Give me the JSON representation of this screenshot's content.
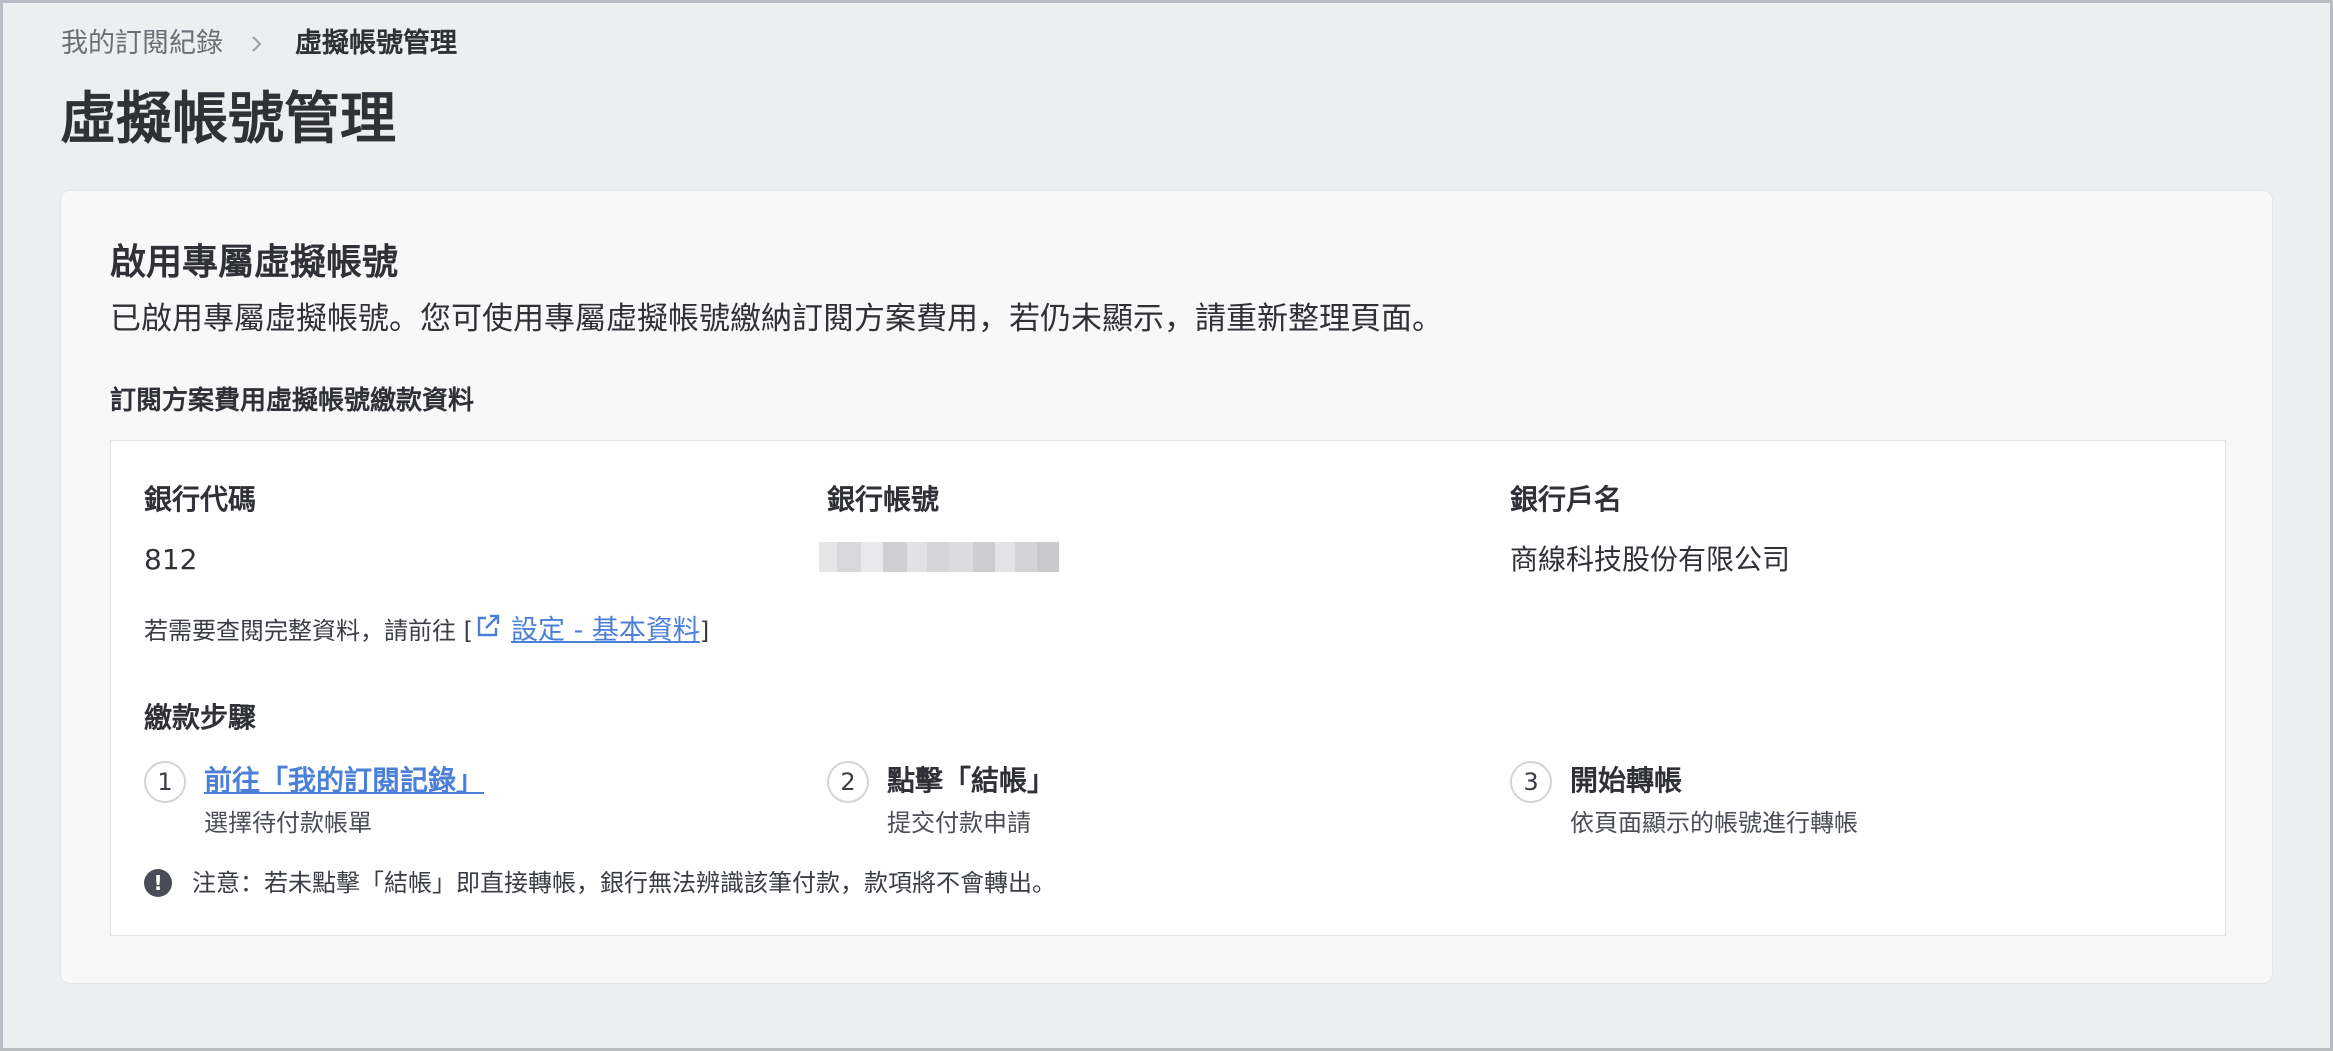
{
  "breadcrumb": {
    "parent": "我的訂閱紀錄",
    "current": "虛擬帳號管理"
  },
  "page_title": "虛擬帳號管理",
  "card": {
    "title": "啟用專屬虛擬帳號",
    "description": "已啟用專屬虛擬帳號。您可使用專屬虛擬帳號繳納訂閱方案費用，若仍未顯示，請重新整理頁面。",
    "section_label": "訂閱方案費用虛擬帳號繳款資料"
  },
  "bank": {
    "code_label": "銀行代碼",
    "code_value": "812",
    "account_label": "銀行帳號",
    "name_label": "銀行戶名",
    "name_value": "商線科技股份有限公司"
  },
  "settings_note": {
    "prefix": "若需要查閱完整資料，請前往 [",
    "link_label": "設定 - 基本資料",
    "suffix": "]"
  },
  "steps": {
    "label": "繳款步驟",
    "items": [
      {
        "num": "1",
        "title": "前往「我的訂閱記錄」",
        "sub": "選擇待付款帳單"
      },
      {
        "num": "2",
        "title": "點擊「結帳」",
        "sub": "提交付款申請"
      },
      {
        "num": "3",
        "title": "開始轉帳",
        "sub": "依頁面顯示的帳號進行轉帳"
      }
    ]
  },
  "warning": "注意：若未點擊「結帳」即直接轉帳，銀行無法辨識該筆付款，款項將不會轉出。",
  "colors": {
    "background": "#edeef0",
    "link": "#4b7fd8",
    "text": "#2f3137"
  },
  "icons": {
    "breadcrumb_separator": "chevron-right-icon",
    "settings_link": "external-link-icon",
    "warning": "exclamation-circle-icon"
  }
}
